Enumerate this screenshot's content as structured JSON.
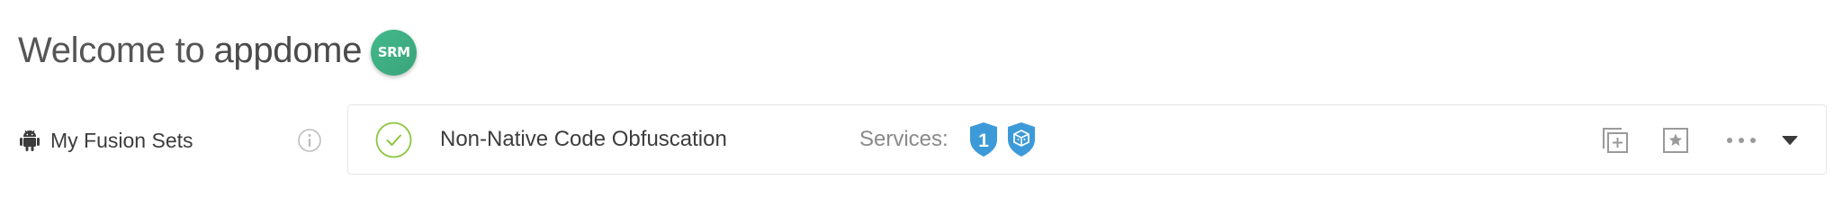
{
  "header": {
    "welcome_text": "Welcome to",
    "brand": "appdome",
    "avatar_initials": "SRM",
    "avatar_color": "#43b98b"
  },
  "sidebar": {
    "platform_icon": "android-icon",
    "label": "My Fusion Sets",
    "info_icon": "info-icon"
  },
  "fusion_set": {
    "status_icon": "check-circle-icon",
    "status_color": "#8cc63f",
    "name": "Non-Native Code Obfuscation",
    "services_label": "Services:",
    "services": [
      {
        "icon": "shield-number-icon",
        "text": "1",
        "color": "#3d9ad8"
      },
      {
        "icon": "shield-cube-icon",
        "text": "",
        "color": "#3d9ad8"
      }
    ],
    "actions": [
      {
        "icon": "duplicate-icon"
      },
      {
        "icon": "favorite-star-icon"
      },
      {
        "icon": "more-dots-icon"
      },
      {
        "icon": "caret-down-icon"
      }
    ]
  }
}
